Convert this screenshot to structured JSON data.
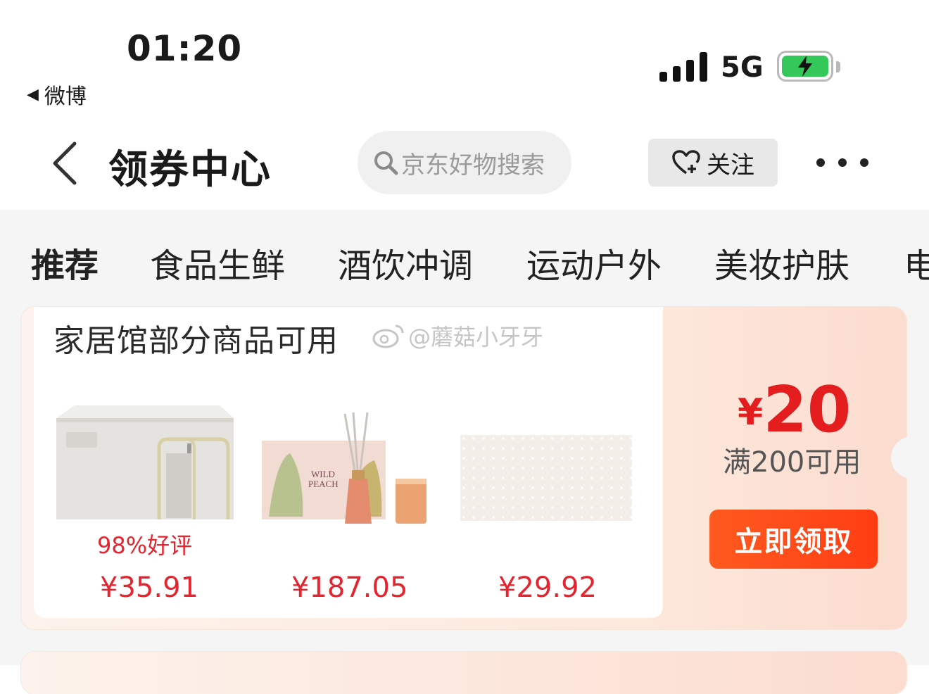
{
  "status_bar": {
    "time": "01:20",
    "back_app": "微博",
    "network": "5G",
    "battery_color": "#34c759"
  },
  "header": {
    "title": "领券中心",
    "search_placeholder": "京东好物搜索",
    "follow_label": "关注",
    "more_icon": "more-dots-icon"
  },
  "tabs": [
    {
      "label": "推荐",
      "active": true
    },
    {
      "label": "食品生鲜",
      "active": false
    },
    {
      "label": "酒饮冲调",
      "active": false
    },
    {
      "label": "运动户外",
      "active": false
    },
    {
      "label": "美妆护肤",
      "active": false
    },
    {
      "label": "电",
      "active": false
    }
  ],
  "coupon": {
    "scope": "家居馆部分商品可用",
    "watermark": "@蘑菇小牙牙",
    "currency": "¥",
    "amount": "20",
    "condition": "满200可用",
    "claim_label": "立即领取",
    "products": [
      {
        "name": "storage-box",
        "rating": "98%好评",
        "price": "¥35.91"
      },
      {
        "name": "aroma-set",
        "image_text": "WILD PEACH",
        "price": "¥187.05"
      },
      {
        "name": "pegboard",
        "price": "¥29.92"
      }
    ]
  },
  "colors": {
    "accent_red": "#e4252f",
    "claim_button": "#ff4a18"
  }
}
